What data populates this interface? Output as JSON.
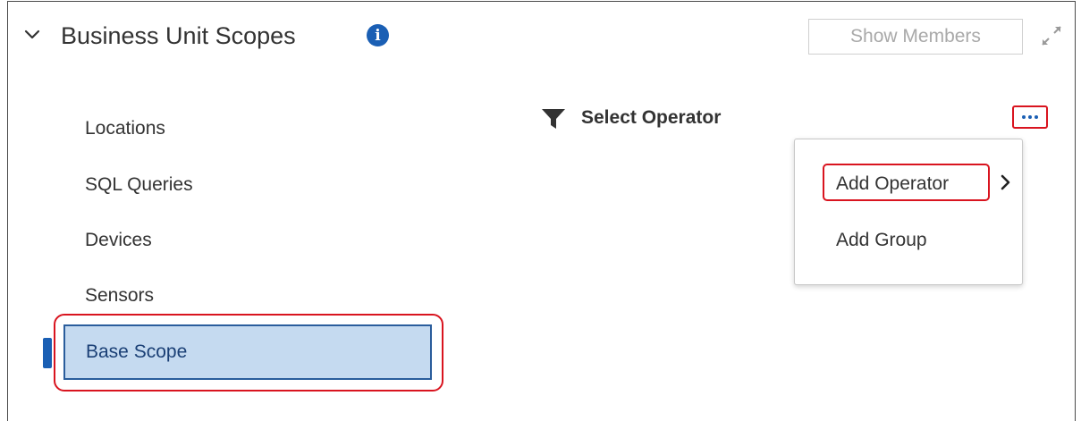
{
  "header": {
    "title": "Business Unit Scopes",
    "info_icon": "info-icon",
    "show_members_label": "Show Members",
    "expand_icon": "expand-arrows-icon",
    "collapse_icon": "chevron-down-icon"
  },
  "sidebar": {
    "items": [
      {
        "label": "Locations",
        "active": false
      },
      {
        "label": "SQL Queries",
        "active": false
      },
      {
        "label": "Devices",
        "active": false
      },
      {
        "label": "Sensors",
        "active": false
      },
      {
        "label": "Base Scope",
        "active": true
      }
    ]
  },
  "main": {
    "filter_icon": "filter-icon",
    "select_operator_label": "Select Operator",
    "more_icon": "ellipsis-icon"
  },
  "menu": {
    "items": [
      {
        "label": "Add Operator",
        "has_submenu": true
      },
      {
        "label": "Add Group",
        "has_submenu": false
      }
    ]
  },
  "colors": {
    "accent": "#1a5fb4",
    "active_bg": "#c5daf0",
    "active_border": "#2a5d9c",
    "highlight": "#d9141f",
    "text": "#333333",
    "muted": "#a9a9a9"
  }
}
